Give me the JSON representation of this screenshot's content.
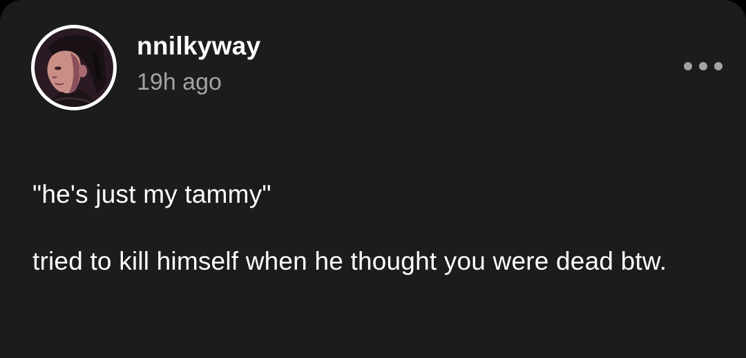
{
  "post": {
    "username": "nnilkyway",
    "timestamp": "19h ago",
    "more_icon": "more-horizontal-icon",
    "avatar_icon": "user-avatar",
    "paragraphs": [
      "\"he's just my tammy\"",
      "tried to kill himself when he thought you were dead btw."
    ]
  },
  "colors": {
    "card_background": "#1c1c1d",
    "text_primary": "#ffffff",
    "text_secondary": "#a3a3a5"
  }
}
